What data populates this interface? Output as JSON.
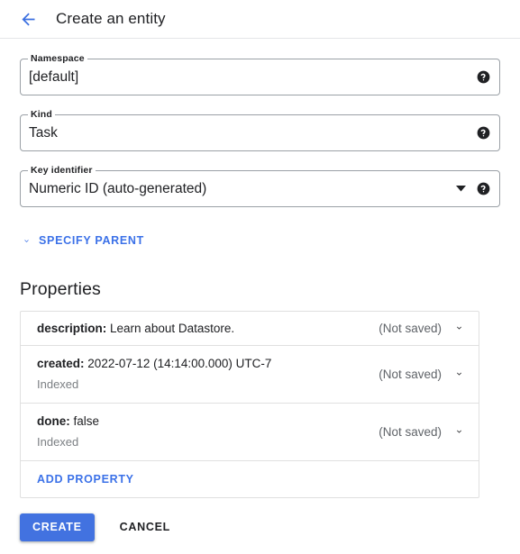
{
  "header": {
    "back_icon": "arrow-back-icon",
    "title": "Create an entity"
  },
  "form": {
    "fields": [
      {
        "label": "Namespace",
        "value": "[default]",
        "type": "text",
        "help_icon": "help-icon"
      },
      {
        "label": "Kind",
        "value": "Task",
        "type": "text",
        "help_icon": "help-icon"
      },
      {
        "label": "Key identifier",
        "value": "Numeric ID (auto-generated)",
        "type": "select",
        "dropdown_icon": "arrow-drop-down-icon",
        "help_icon": "help-icon"
      }
    ],
    "specify_parent": {
      "label": "SPECIFY PARENT",
      "icon": "chevron-down-icon"
    }
  },
  "properties": {
    "heading": "Properties",
    "rows": [
      {
        "key": "description:",
        "value": "Learn about Datastore.",
        "sub": "",
        "status": "(Not saved)",
        "expand_icon": "chevron-down-icon"
      },
      {
        "key": "created:",
        "value": "2022-07-12 (14:14:00.000) UTC-7",
        "sub": "Indexed",
        "status": "(Not saved)",
        "expand_icon": "chevron-down-icon"
      },
      {
        "key": "done:",
        "value": "false",
        "sub": "Indexed",
        "status": "(Not saved)",
        "expand_icon": "chevron-down-icon"
      }
    ],
    "add_property_label": "ADD PROPERTY"
  },
  "footer": {
    "create_label": "CREATE",
    "cancel_label": "CANCEL"
  },
  "colors": {
    "accent_blue": "#3b71e8",
    "button_blue": "#4272e0",
    "border_gray": "#e0e0e0",
    "field_border": "#9aa0a6",
    "text_primary": "#202124",
    "text_secondary": "#5f6368"
  }
}
